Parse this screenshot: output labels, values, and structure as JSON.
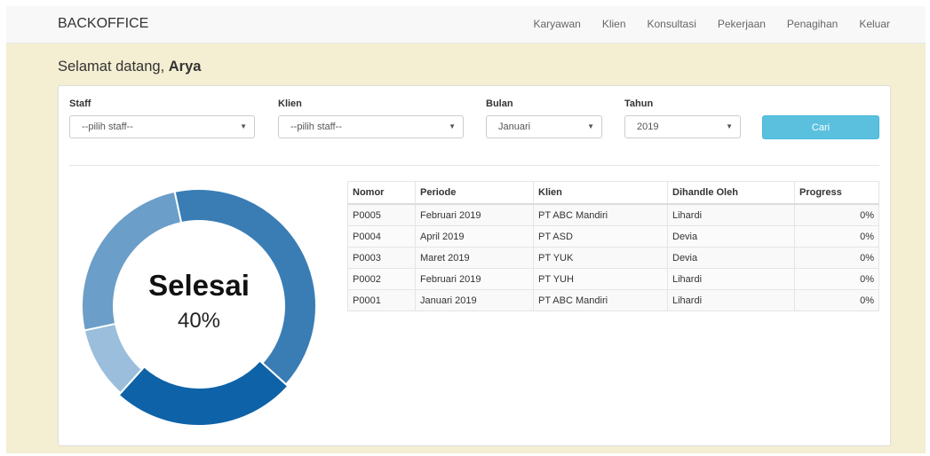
{
  "navbar": {
    "brand": "BACKOFFICE",
    "items": [
      {
        "label": "Karyawan"
      },
      {
        "label": "Klien"
      },
      {
        "label": "Konsultasi"
      },
      {
        "label": "Pekerjaan"
      },
      {
        "label": "Penagihan"
      },
      {
        "label": "Keluar"
      }
    ]
  },
  "welcome": {
    "prefix": "Selamat datang,",
    "name": "Arya"
  },
  "filters": {
    "staff": {
      "label": "Staff",
      "value": "--pilih staff--"
    },
    "klien": {
      "label": "Klien",
      "value": "--pilih staff--"
    },
    "bulan": {
      "label": "Bulan",
      "value": "Januari"
    },
    "tahun": {
      "label": "Tahun",
      "value": "2019"
    },
    "search_button": "Cari"
  },
  "donut": {
    "title": "Selesai",
    "percent": "40%",
    "colors": [
      "#3a7db5",
      "#0e62a8",
      "#9abedb",
      "#6b9ec8"
    ],
    "segments": [
      0.4,
      0.25,
      0.1,
      0.25
    ]
  },
  "table": {
    "headers": [
      "Nomor",
      "Periode",
      "Klien",
      "Dihandle Oleh",
      "Progress"
    ],
    "rows": [
      [
        "P0005",
        "Februari 2019",
        "PT ABC Mandiri",
        "Lihardi",
        "0%"
      ],
      [
        "P0004",
        "April 2019",
        "PT ASD",
        "Devia",
        "0%"
      ],
      [
        "P0003",
        "Maret 2019",
        "PT YUK",
        "Devia",
        "0%"
      ],
      [
        "P0002",
        "Februari 2019",
        "PT YUH",
        "Lihardi",
        "0%"
      ],
      [
        "P0001",
        "Januari 2019",
        "PT ABC Mandiri",
        "Lihardi",
        "0%"
      ]
    ]
  }
}
